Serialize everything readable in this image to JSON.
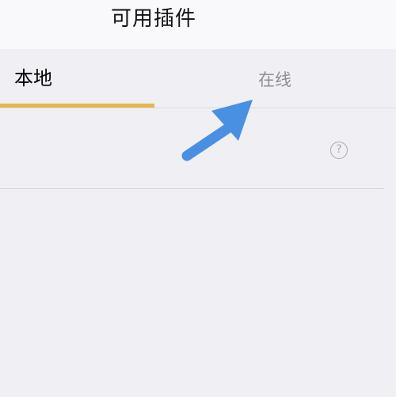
{
  "header": {
    "title": "可用插件"
  },
  "tabs": [
    {
      "label": "本地",
      "active": true
    },
    {
      "label": "在线",
      "active": false
    }
  ],
  "plugin_row": {
    "help_icon": "?"
  },
  "colors": {
    "background": "#efeff4",
    "header_background": "#f9f9fb",
    "active_tab_indicator": "#e5b64a",
    "inactive_tab_text": "#8f8f94",
    "annotation_arrow": "#4a90e2"
  },
  "icons": {
    "help": "question-circle-icon",
    "annotation": "arrow-annotation-icon"
  }
}
